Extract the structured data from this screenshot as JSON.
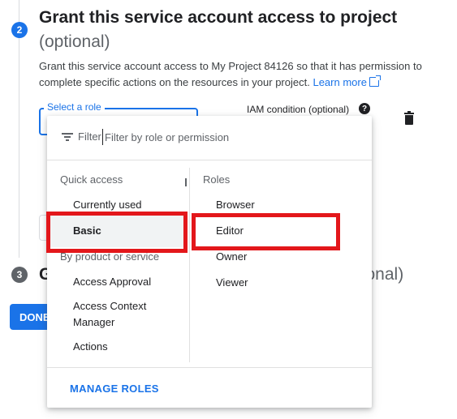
{
  "step2": {
    "number": "2",
    "title": "Grant this service account access to project",
    "subtitle": "(optional)",
    "description": "Grant this service account access to My Project 84126 so that it has permission to complete specific actions on the resources in your project.",
    "learn_more": "Learn more"
  },
  "role_select": {
    "label": "Select a role"
  },
  "iam_condition": {
    "label": "IAM condition (optional)",
    "help": "?"
  },
  "step3": {
    "number": "3",
    "title_partial": "G",
    "optional_partial": "tional)"
  },
  "done_button": "DONE",
  "dropdown": {
    "filter_label": "Filter",
    "filter_placeholder": "Filter by role or permission",
    "left_column": {
      "quick_access_header": "Quick access",
      "quick_items": [
        "Currently used",
        "Basic"
      ],
      "product_header": "By product or service",
      "product_items": [
        "Access Approval",
        "Access Context\nManager",
        "Actions"
      ]
    },
    "right_column": {
      "header": "Roles",
      "items": [
        "Browser",
        "Editor",
        "Owner",
        "Viewer"
      ]
    },
    "manage_roles": "MANAGE ROLES"
  },
  "colors": {
    "accent": "#1a73e8",
    "highlight": "#e3171b"
  }
}
